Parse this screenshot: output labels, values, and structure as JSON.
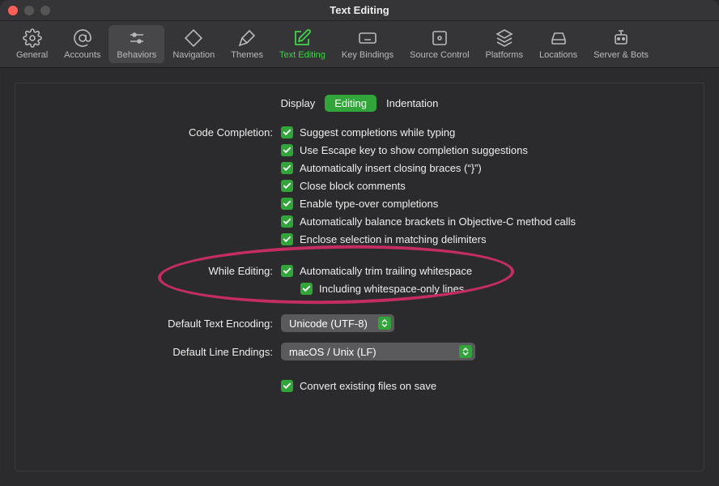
{
  "window": {
    "title": "Text Editing"
  },
  "toolbar": {
    "items": [
      {
        "label": "General"
      },
      {
        "label": "Accounts"
      },
      {
        "label": "Behaviors"
      },
      {
        "label": "Navigation"
      },
      {
        "label": "Themes"
      },
      {
        "label": "Text Editing"
      },
      {
        "label": "Key Bindings"
      },
      {
        "label": "Source Control"
      },
      {
        "label": "Platforms"
      },
      {
        "label": "Locations"
      },
      {
        "label": "Server & Bots"
      }
    ]
  },
  "tabs": {
    "items": [
      {
        "label": "Display"
      },
      {
        "label": "Editing"
      },
      {
        "label": "Indentation"
      }
    ]
  },
  "sections": {
    "codeCompletion": {
      "label": "Code Completion:",
      "opts": [
        "Suggest completions while typing",
        "Use Escape key to show completion suggestions",
        "Automatically insert closing braces (“}”)",
        "Close block comments",
        "Enable type-over completions",
        "Automatically balance brackets in Objective-C method calls",
        "Enclose selection in matching delimiters"
      ]
    },
    "whileEditing": {
      "label": "While Editing:",
      "opt1": "Automatically trim trailing whitespace",
      "opt2": "Including whitespace-only lines"
    },
    "encoding": {
      "label": "Default Text Encoding:",
      "value": "Unicode (UTF-8)"
    },
    "lineEndings": {
      "label": "Default Line Endings:",
      "value": "macOS / Unix (LF)"
    },
    "convert": {
      "label": "Convert existing files on save"
    }
  }
}
